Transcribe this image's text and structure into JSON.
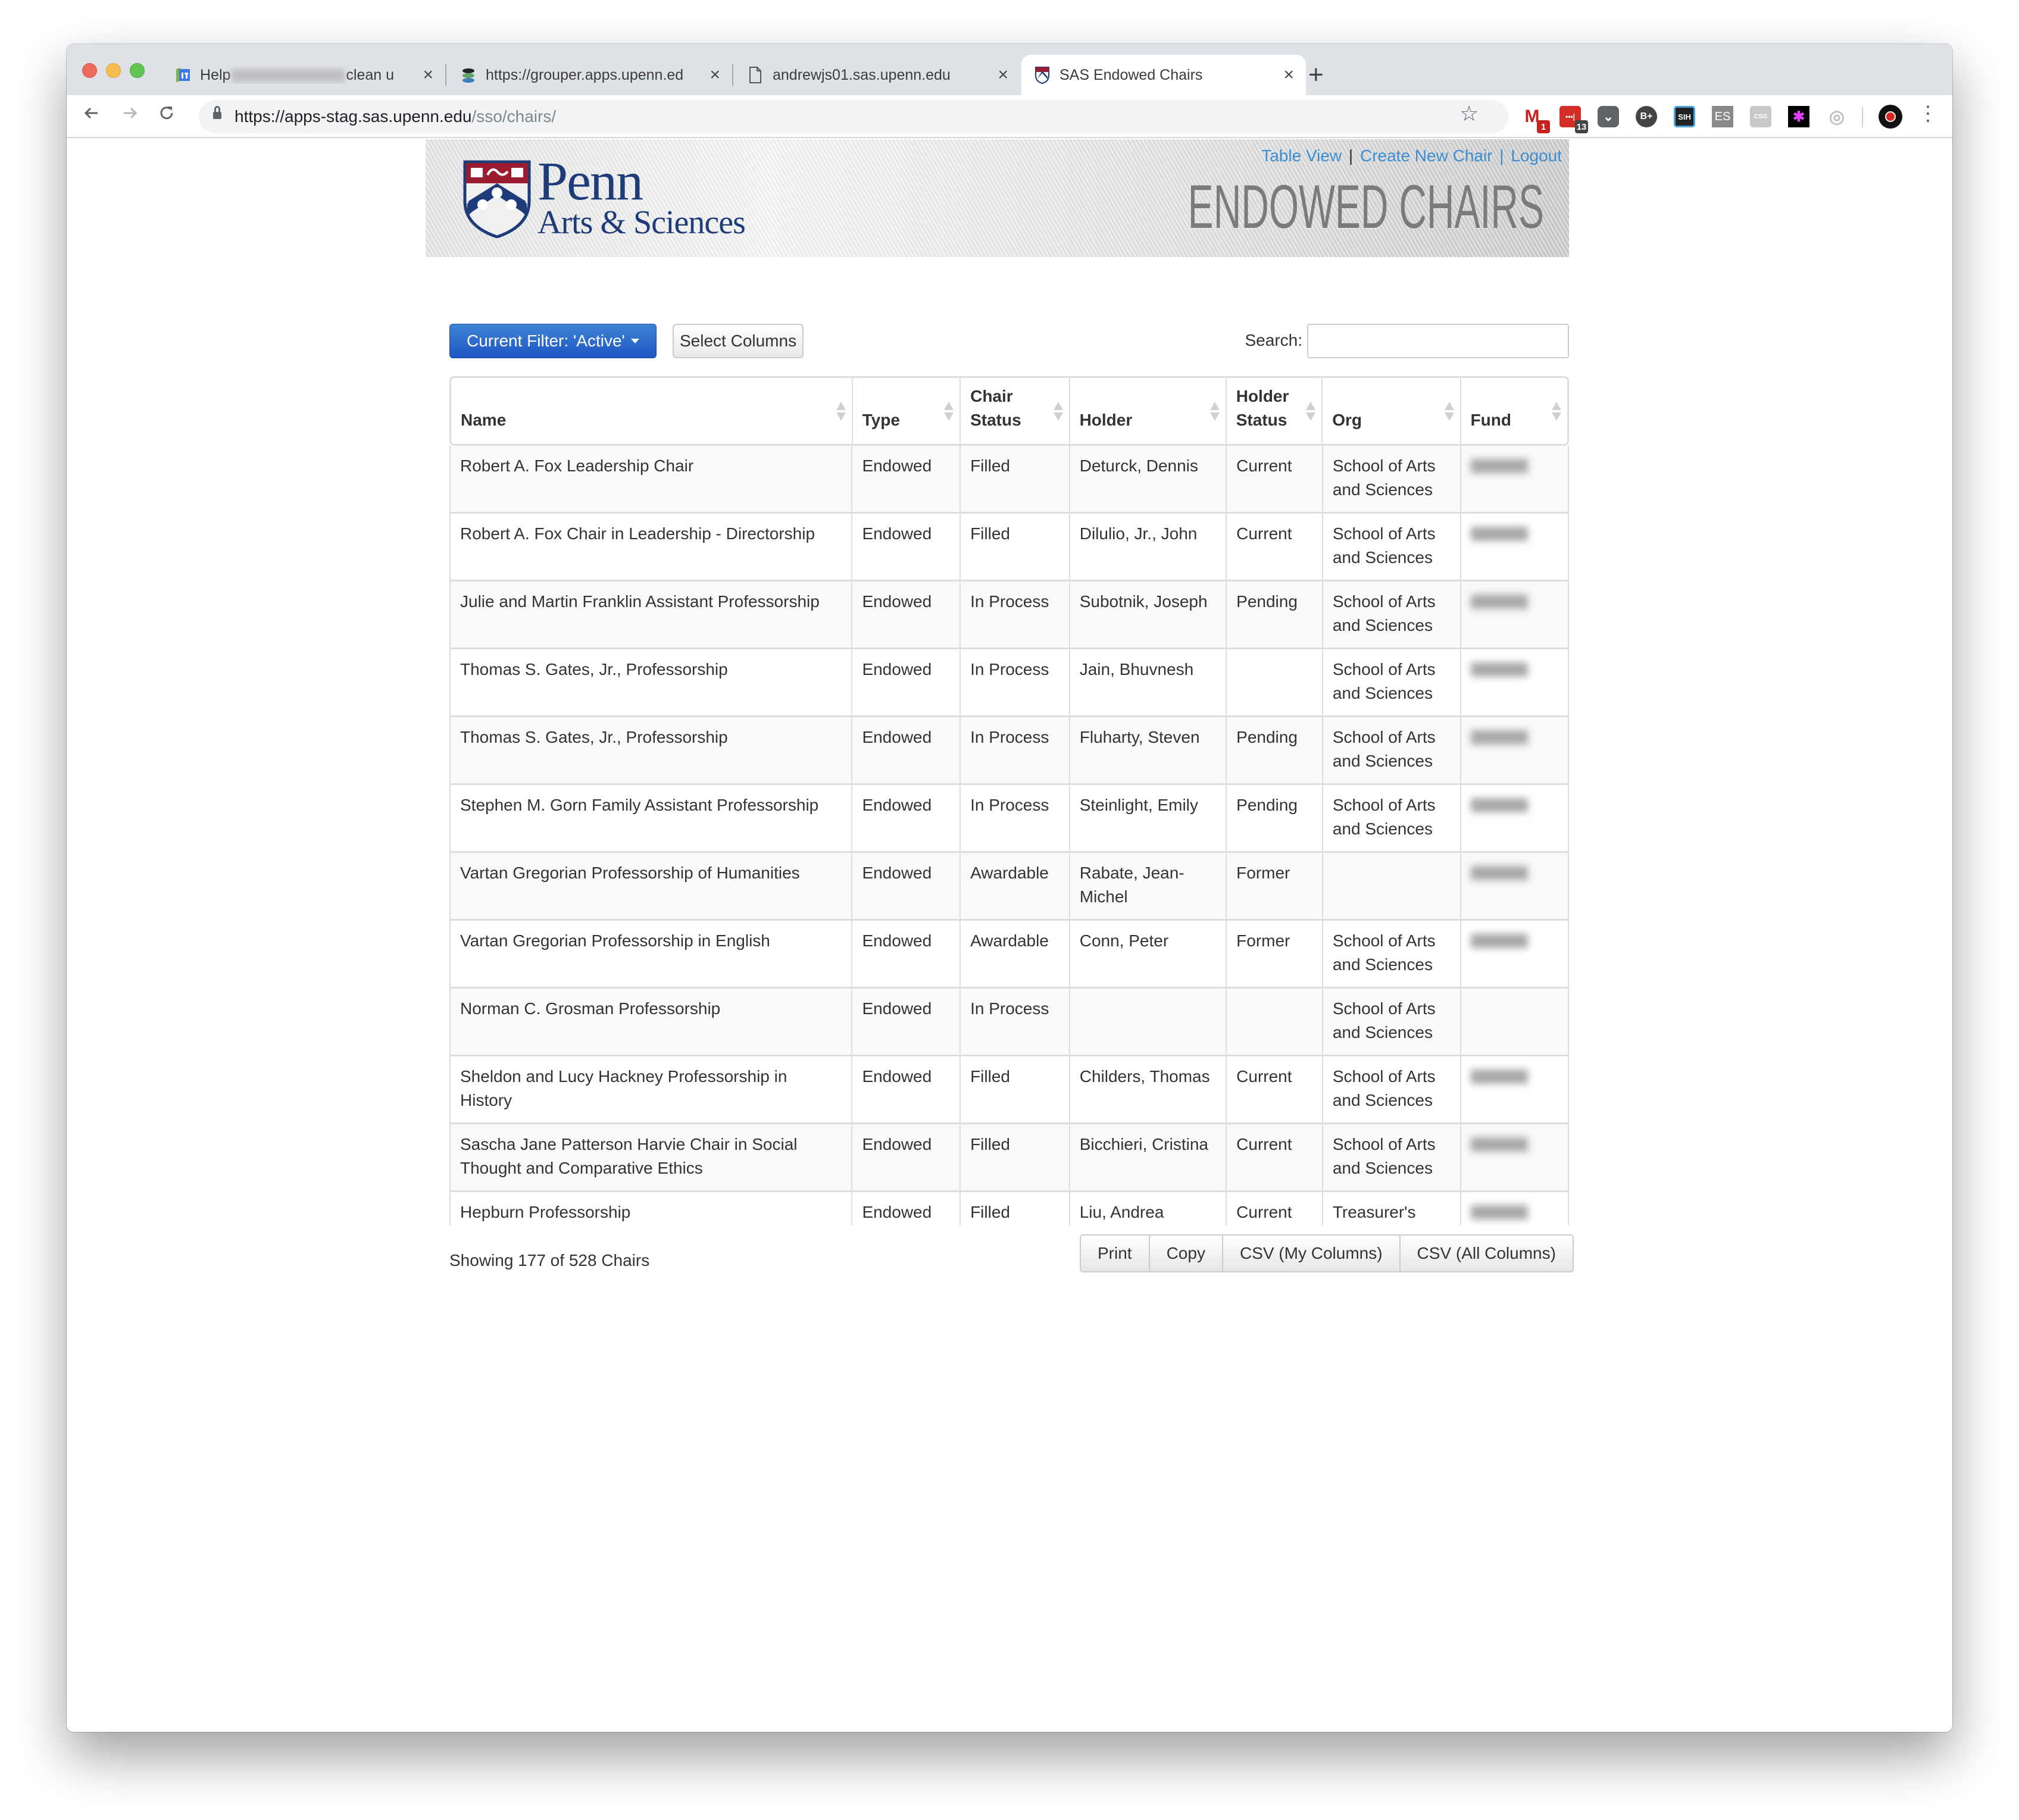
{
  "browser": {
    "tabs": [
      {
        "title_prefix": "Help",
        "title_suffix": "clean u",
        "favicon": "tasks-icon",
        "active": false
      },
      {
        "title": "https://grouper.apps.upenn.ed",
        "favicon": "grouper-icon",
        "active": false
      },
      {
        "title": "andrewjs01.sas.upenn.edu",
        "favicon": "document-icon",
        "active": false
      },
      {
        "title": "SAS Endowed Chairs",
        "favicon": "penn-shield-icon",
        "active": true
      }
    ],
    "close_glyph": "×",
    "new_tab_glyph": "+",
    "url_host": "https://apps-stag.sas.upenn.edu",
    "url_path": "/sso/chairs/",
    "extensions": [
      {
        "name": "gmail-checker",
        "label": "M",
        "badge": "1",
        "color": "#c5221f",
        "badge_color": "#c5221f"
      },
      {
        "name": "lastpass",
        "label": "•••|",
        "badge": "13",
        "color": "#d32d27",
        "badge_color": "#444444"
      },
      {
        "name": "pocket",
        "label": "⌄",
        "color": "#5f6368"
      },
      {
        "name": "bplus",
        "label": "B+",
        "color": "#444444"
      },
      {
        "name": "sih",
        "label": "SIH",
        "color": "#222222"
      },
      {
        "name": "es",
        "label": "ES",
        "color": "#8a8a8a"
      },
      {
        "name": "css-viewer",
        "label": "CSS",
        "color": "#c8c8c8"
      },
      {
        "name": "color-picker",
        "label": "✱",
        "color": "#000000"
      },
      {
        "name": "circle-ext",
        "label": "◎",
        "color": "#ffffff"
      }
    ]
  },
  "banner": {
    "logo_word": "Penn",
    "logo_sub": "Arts & Sciences",
    "title": "ENDOWED CHAIRS",
    "links": [
      "Table View",
      "Create New Chair",
      "Logout"
    ],
    "separator": "|"
  },
  "controls": {
    "filter_label": "Current Filter: 'Active'",
    "select_columns_label": "Select Columns",
    "search_label": "Search:",
    "search_value": ""
  },
  "table": {
    "columns": [
      "Name",
      "Type",
      "Chair Status",
      "Holder",
      "Holder Status",
      "Org",
      "Fund"
    ],
    "rows": [
      {
        "name": "Robert A. Fox Leadership Chair",
        "type": "Endowed",
        "chair_status": "Filled",
        "holder": "Deturck, Dennis",
        "holder_status": "Current",
        "org": "School of Arts and Sciences",
        "fund": "redacted"
      },
      {
        "name": "Robert A. Fox Chair in Leadership - Directorship",
        "type": "Endowed",
        "chair_status": "Filled",
        "holder": "Dilulio, Jr., John",
        "holder_status": "Current",
        "org": "School of Arts and Sciences",
        "fund": "redacted"
      },
      {
        "name": "Julie and Martin Franklin Assistant Professorship",
        "type": "Endowed",
        "chair_status": "In Process",
        "holder": "Subotnik, Joseph",
        "holder_status": "Pending",
        "org": "School of Arts and Sciences",
        "fund": "redacted"
      },
      {
        "name": "Thomas S. Gates, Jr., Professorship",
        "type": "Endowed",
        "chair_status": "In Process",
        "holder": "Jain, Bhuvnesh",
        "holder_status": "",
        "org": "School of Arts and Sciences",
        "fund": "redacted"
      },
      {
        "name": "Thomas S. Gates, Jr., Professorship",
        "type": "Endowed",
        "chair_status": "In Process",
        "holder": "Fluharty, Steven",
        "holder_status": "Pending",
        "org": "School of Arts and Sciences",
        "fund": "redacted"
      },
      {
        "name": "Stephen M. Gorn Family Assistant Professorship",
        "type": "Endowed",
        "chair_status": "In Process",
        "holder": "Steinlight, Emily",
        "holder_status": "Pending",
        "org": "School of Arts and Sciences",
        "fund": "redacted"
      },
      {
        "name": "Vartan Gregorian Professorship of Humanities",
        "type": "Endowed",
        "chair_status": "Awardable",
        "holder": "Rabate, Jean-Michel",
        "holder_status": "Former",
        "org": "",
        "fund": "redacted"
      },
      {
        "name": "Vartan Gregorian Professorship in English",
        "type": "Endowed",
        "chair_status": "Awardable",
        "holder": "Conn, Peter",
        "holder_status": "Former",
        "org": "School of Arts and Sciences",
        "fund": "redacted"
      },
      {
        "name": "Norman C. Grosman Professorship",
        "type": "Endowed",
        "chair_status": "In Process",
        "holder": "",
        "holder_status": "",
        "org": "School of Arts and Sciences",
        "fund": ""
      },
      {
        "name": "Sheldon and Lucy Hackney Professorship in History",
        "type": "Endowed",
        "chair_status": "Filled",
        "holder": "Childers, Thomas",
        "holder_status": "Current",
        "org": "School of Arts and Sciences",
        "fund": "redacted"
      },
      {
        "name": "Sascha Jane Patterson Harvie Chair in Social Thought and Comparative Ethics",
        "type": "Endowed",
        "chair_status": "Filled",
        "holder": "Bicchieri, Cristina",
        "holder_status": "Current",
        "org": "School of Arts and Sciences",
        "fund": "redacted"
      },
      {
        "name": "Hepburn Professorship",
        "type": "Endowed",
        "chair_status": "Filled",
        "holder": "Liu, Andrea",
        "holder_status": "Current",
        "org": "Treasurer's",
        "fund": "redacted"
      }
    ]
  },
  "footer": {
    "info": "Showing 177 of 528 Chairs",
    "buttons": [
      "Print",
      "Copy",
      "CSV (My Columns)",
      "CSV (All Columns)"
    ]
  },
  "colors": {
    "link": "#3c8dd1",
    "filter_button": "#1f55c3",
    "penn_blue": "#1f3c7a",
    "penn_red": "#9b1c2e",
    "row_stripe": "#f9f9f9"
  }
}
